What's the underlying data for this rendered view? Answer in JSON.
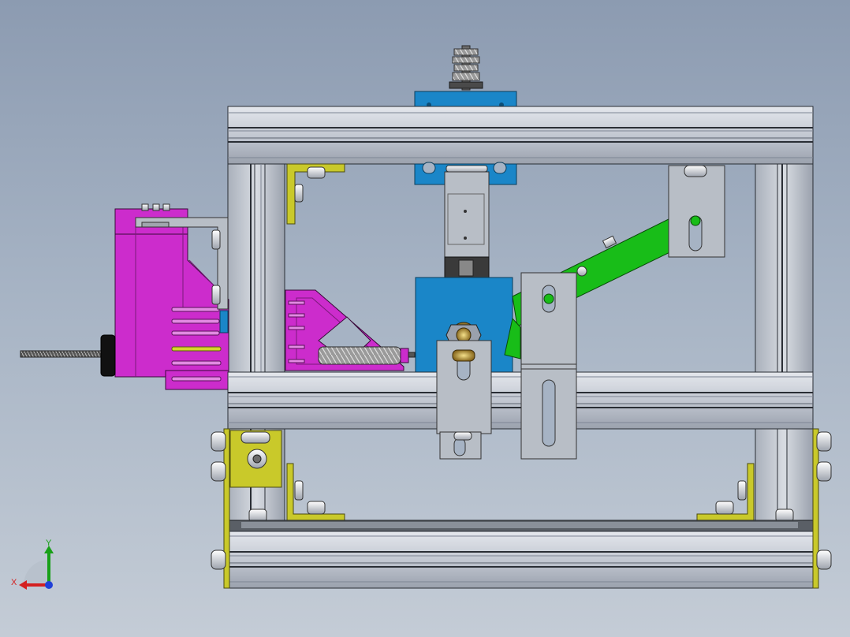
{
  "viewport": {
    "background_top": "#8c9bb1",
    "background_bottom": "#c4ccd6"
  },
  "colors": {
    "aluminum_profile": "#c3c8d2",
    "aluminum_shadow": "#7d8594",
    "bracket_yellow": "#c9c92a",
    "motor_mount_magenta": "#cc2ccc",
    "link_green": "#18bd18",
    "block_blue": "#1a86c8",
    "plate_gray": "#b8bec6",
    "axis_x": "#d42020",
    "axis_y": "#18a018",
    "axis_z": "#2040d8"
  },
  "triad": {
    "x_label": "X",
    "y_label": "Y",
    "x_icon": "x-axis-arrow-icon",
    "y_icon": "y-axis-arrow-icon",
    "z_icon": "z-axis-dot-icon"
  }
}
